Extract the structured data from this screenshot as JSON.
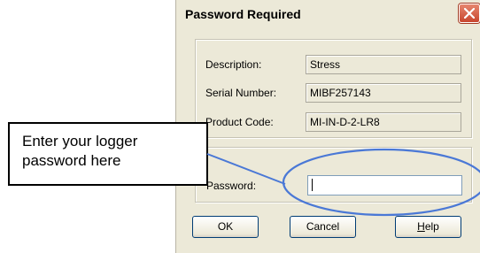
{
  "dialog": {
    "title": "Password Required",
    "close_icon": "close-icon",
    "fields": [
      {
        "label": "Description:",
        "value": "Stress"
      },
      {
        "label": "Serial Number:",
        "value": "MIBF257143"
      },
      {
        "label": "Product Code:",
        "value": "MI-IN-D-2-LR8"
      }
    ],
    "password": {
      "label": "Password:",
      "value": ""
    },
    "buttons": {
      "ok": "OK",
      "cancel": "Cancel",
      "help_first": "H",
      "help_rest": "elp"
    }
  },
  "callout": {
    "line1": "Enter your logger",
    "line2": "password here"
  },
  "colors": {
    "dialog_bg": "#ece9d8",
    "close_button": "#c8462e",
    "annotation": "#4a78d6"
  }
}
